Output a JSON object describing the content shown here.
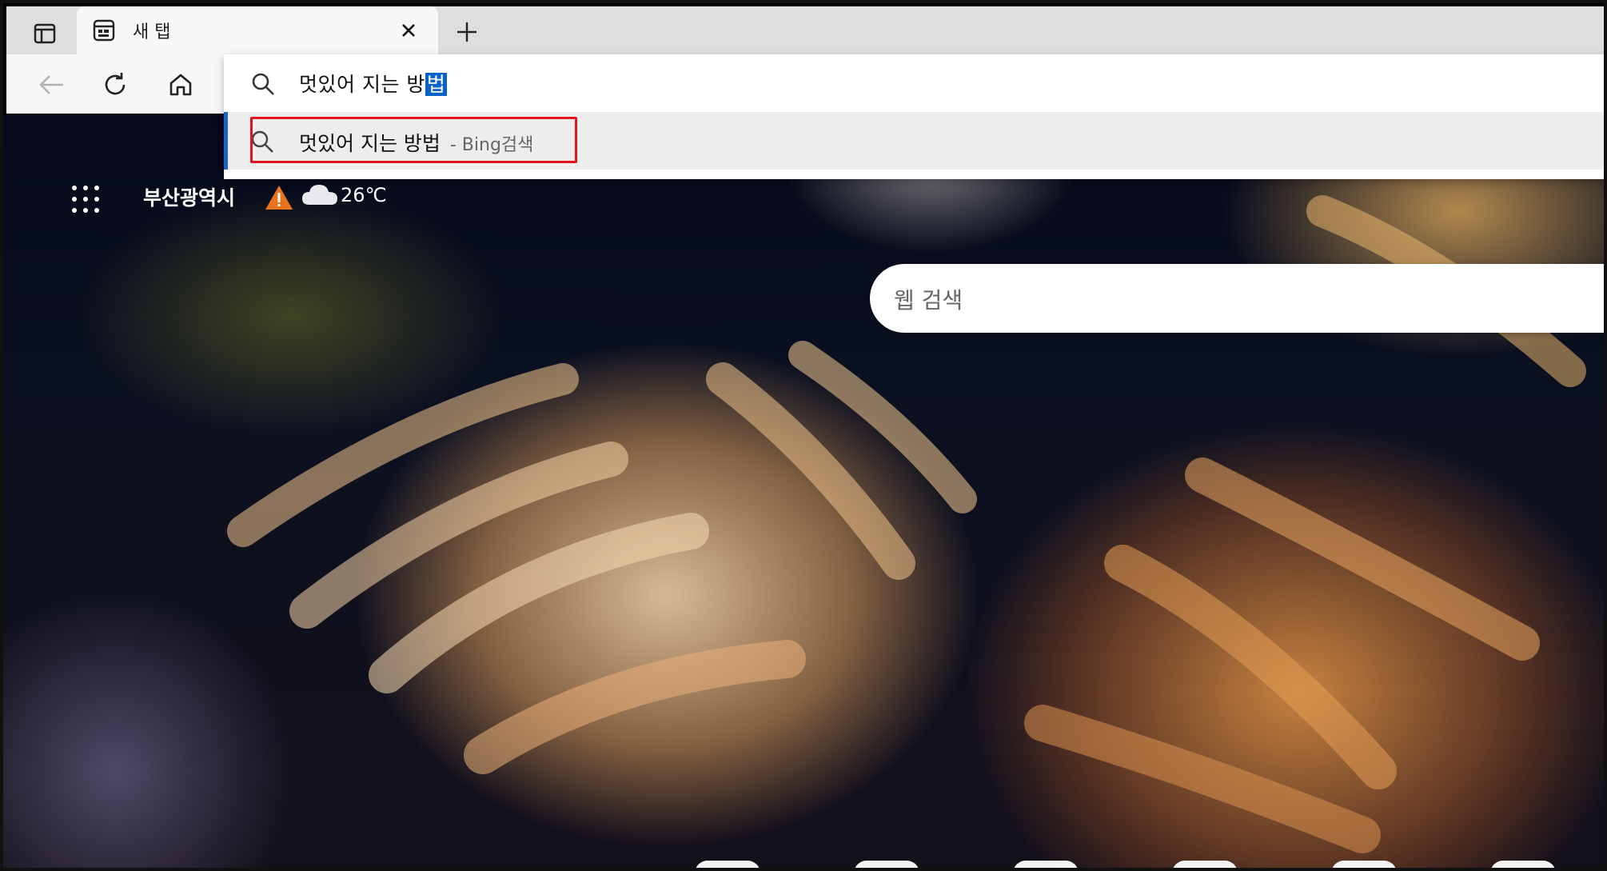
{
  "tab": {
    "title": "새 탭"
  },
  "address": {
    "typed_prefix": "멋있어 지는 방",
    "selected_suffix": "법"
  },
  "suggestion": {
    "query": "멋있어 지는 방법",
    "engine": "- Bing검색"
  },
  "weather": {
    "location": "부산광역시",
    "temperature": "26℃",
    "alert_color": "#e8731c"
  },
  "search": {
    "placeholder": "웹 검색"
  },
  "colors": {
    "accent": "#1a63c8",
    "selection": "#0a62c9",
    "highlight_box": "#e3141c"
  },
  "icons": [
    "tab-actions-icon",
    "newtab-page-icon",
    "close-icon",
    "plus-icon",
    "back-icon",
    "refresh-icon",
    "home-icon",
    "search-icon",
    "apps-grid-icon",
    "warning-icon",
    "cloud-icon"
  ]
}
